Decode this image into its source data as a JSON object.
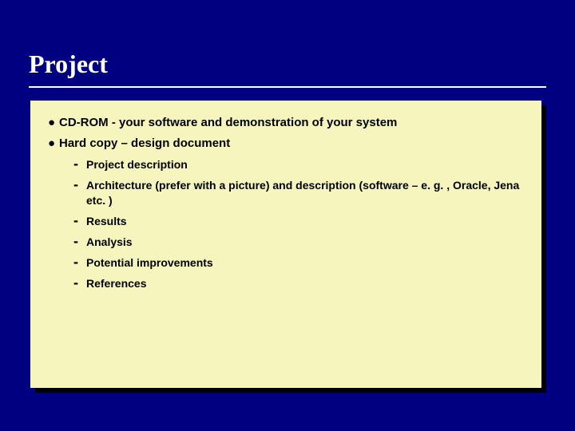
{
  "title": "Project",
  "bullets": {
    "b1": "CD-ROM - your software and demonstration of your system",
    "b2": "Hard copy – design document",
    "sub1": "Project description",
    "sub2": "Architecture  (prefer with a picture) and description (software – e. g. , Oracle, Jena etc. )",
    "sub3": "Results",
    "sub4": "Analysis",
    "sub5": "Potential improvements",
    "sub6": "References"
  }
}
